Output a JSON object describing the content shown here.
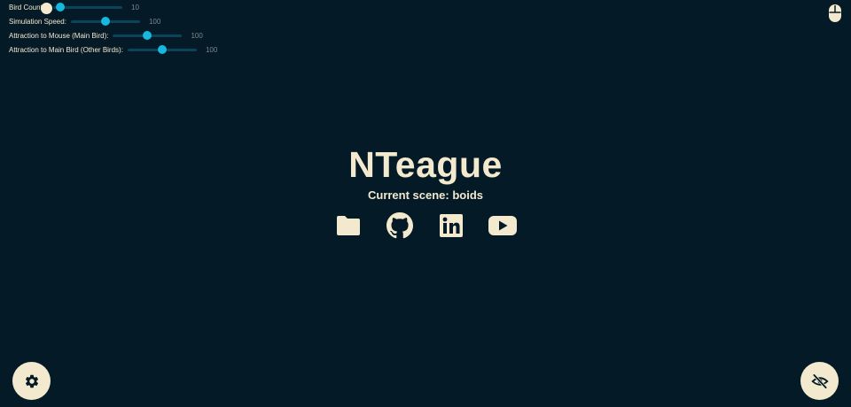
{
  "controls": [
    {
      "label": "Bird Count:",
      "value": "10",
      "fraction": 0.1
    },
    {
      "label": "Simulation Speed:",
      "value": "100",
      "fraction": 0.5
    },
    {
      "label": "Attraction to Mouse (Main Bird):",
      "value": "100",
      "fraction": 0.5
    },
    {
      "label": "Attraction to Main Bird (Other Birds):",
      "value": "100",
      "fraction": 0.5
    }
  ],
  "main": {
    "title": "NTeague",
    "scene_text": "Current scene: boids"
  },
  "links": [
    {
      "icon": "folder-icon"
    },
    {
      "icon": "github-icon"
    },
    {
      "icon": "linkedin-icon"
    },
    {
      "icon": "youtube-icon"
    }
  ],
  "buttons": {
    "settings_icon": "gear-icon",
    "visibility_icon": "eye-off-icon"
  },
  "colors": {
    "background": "#041a26",
    "foreground": "#f2e9cf",
    "accent": "#17b7df"
  }
}
